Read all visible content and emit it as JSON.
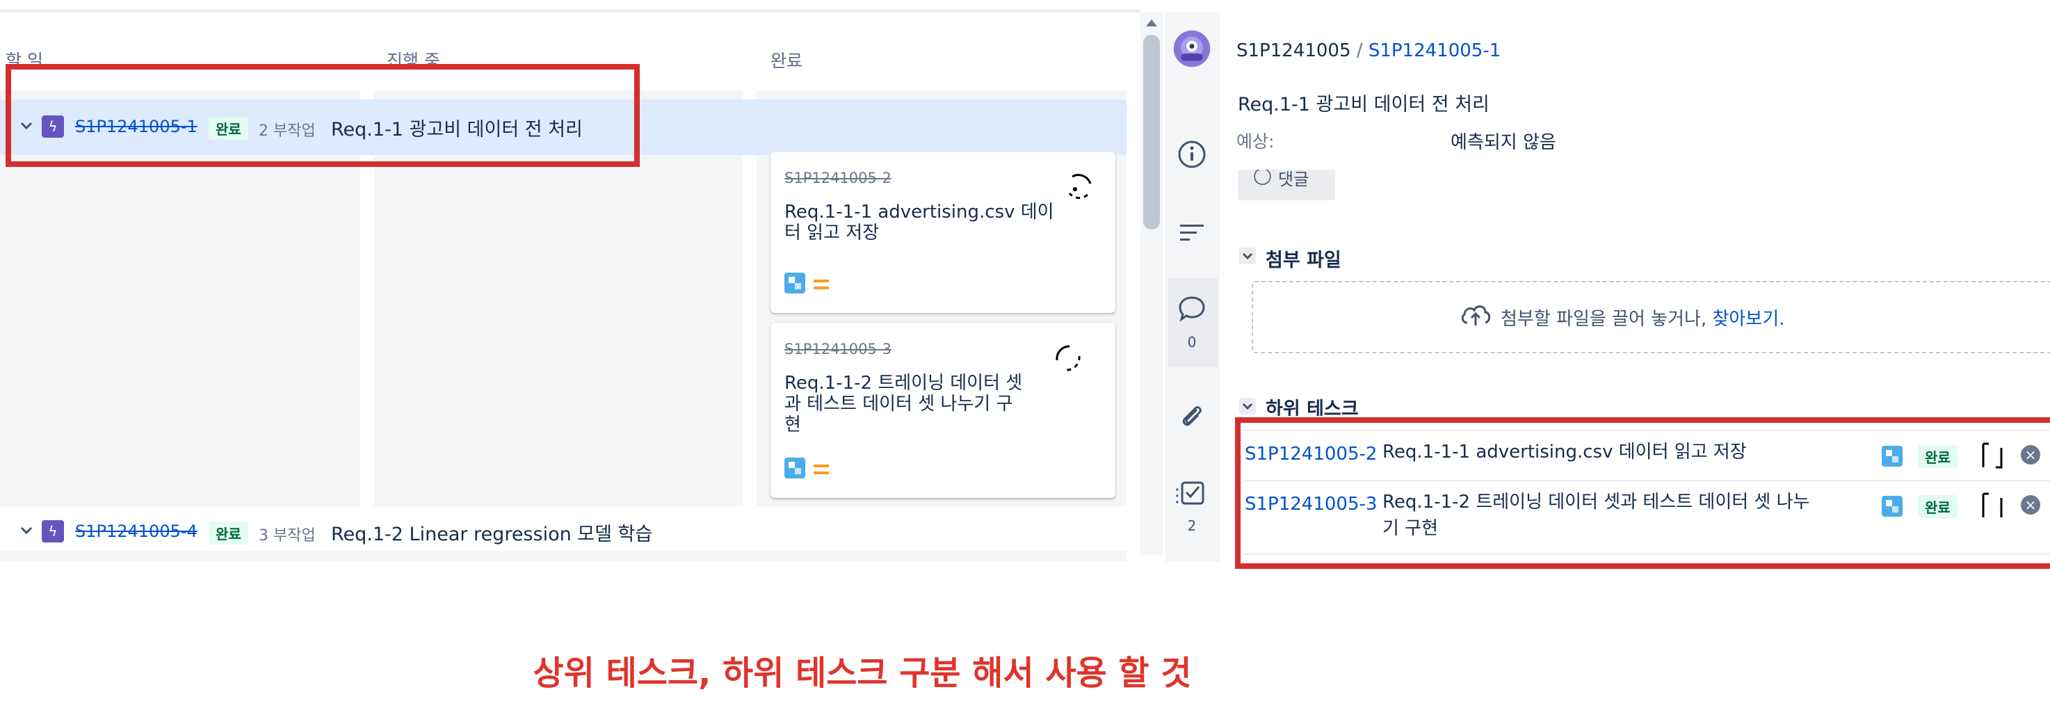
{
  "board": {
    "columns": [
      "할 일",
      "진행 중",
      "완료"
    ],
    "swimlanes": [
      {
        "key": "S1P1241005-1",
        "status": "완료",
        "subtasks": "2 부작업",
        "title": "Req.1-1 광고비 데이터 전 처리"
      },
      {
        "key": "S1P1241005-4",
        "status": "완료",
        "subtasks": "3 부작업",
        "title": "Req.1-2 Linear regression 모델 학습"
      }
    ],
    "cards": [
      {
        "key": "S1P1241005-2",
        "title_line1": "Req.1-1-1 advertising.csv 데이",
        "title_line2": "터 읽고 저장"
      },
      {
        "key": "S1P1241005-3",
        "title_line1": "Req.1-1-2 트레이닝 데이터 셋",
        "title_line2": "과 테스트 데이터 셋 나누기 구",
        "title_line3": "현"
      }
    ]
  },
  "rail": {
    "comment_count": "0",
    "checklist_count": "2"
  },
  "detail": {
    "breadcrumb_parent": "S1P1241005",
    "breadcrumb_sep": " / ",
    "breadcrumb_current": "S1P1241005-1",
    "title": "Req.1-1 광고비 데이터 전 처리",
    "estimate_label": "예상:",
    "estimate_value": "예측되지 않음",
    "comment_button": "댓글",
    "attachments_heading": "첨부 파일",
    "drop_text": "첨부할 파일을 끌어 놓거나, ",
    "drop_link": "찾아보기.",
    "subtasks_heading": "하위 테스크",
    "subtasks": [
      {
        "key": "S1P1241005-2",
        "title_line1": "Req.1-1-1 advertising.csv 데이터 읽고 저장",
        "title_line2": "",
        "status": "완료"
      },
      {
        "key": "S1P1241005-3",
        "title_line1": "Req.1-1-2 트레이닝 데이터 셋과 테스트 데이터 셋 나누",
        "title_line2": "기 구현",
        "status": "완료"
      }
    ]
  },
  "annotation": "상위 테스크, 하위 테스크 구분 해서 사용 할 것",
  "colors": {
    "accent": "#0052cc",
    "epic": "#6554c0",
    "done_bg": "#e3fcef",
    "done_fg": "#006644",
    "annotation_red": "#d32f2f"
  }
}
